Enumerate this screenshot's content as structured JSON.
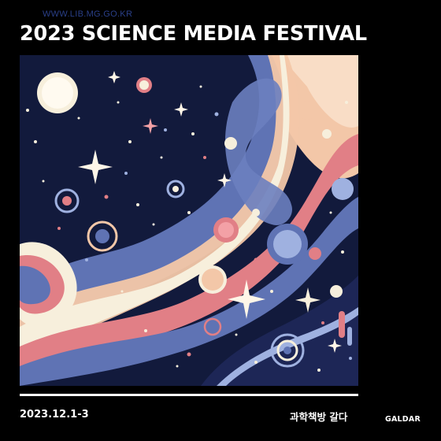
{
  "header": {
    "url": "WWW.LIB.MG.GO.KR",
    "title": "2023 SCIENCE MEDIA FESTIVAL"
  },
  "footer": {
    "date": "2023.12.1-3",
    "subtitle": "과학책방 갈다",
    "brand": "GALDAR"
  },
  "artwork": {
    "icon": "cosmic-illustration",
    "colors": {
      "background": "#111a3a",
      "blue": "#5f73b4",
      "light_blue": "#9fb1e0",
      "pink": "#e17f86",
      "peach": "#f3c7a8",
      "cream": "#f7efdc",
      "navy": "#1a2250"
    }
  }
}
